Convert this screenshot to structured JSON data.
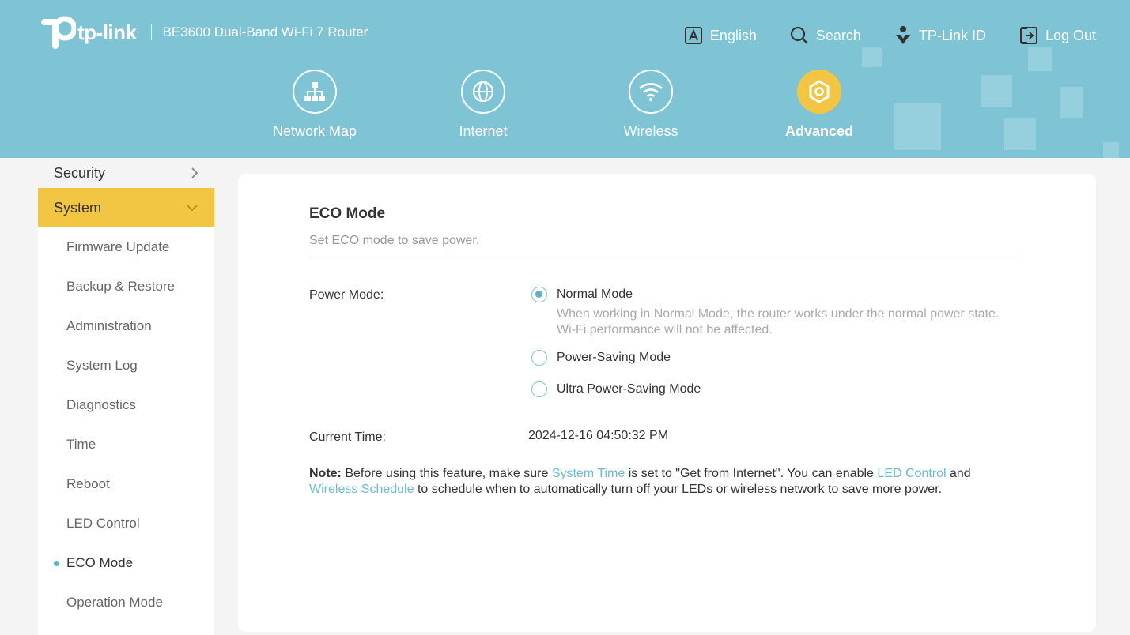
{
  "brand": {
    "logo_text": "tp-link",
    "model": "BE3600 Dual-Band Wi-Fi 7 Router"
  },
  "top_actions": {
    "language": "English",
    "search": "Search",
    "tplink_id": "TP-Link ID",
    "logout": "Log Out"
  },
  "nav": {
    "network_map": "Network Map",
    "internet": "Internet",
    "wireless": "Wireless",
    "advanced": "Advanced",
    "active": "Advanced"
  },
  "sidebar": {
    "security": "Security",
    "system": "System",
    "items": [
      "Firmware Update",
      "Backup & Restore",
      "Administration",
      "System Log",
      "Diagnostics",
      "Time",
      "Reboot",
      "LED Control",
      "ECO Mode",
      "Operation Mode"
    ],
    "active_item": "ECO Mode"
  },
  "content": {
    "title": "ECO Mode",
    "description": "Set ECO mode to save power.",
    "power_mode_label": "Power Mode:",
    "options": {
      "normal": "Normal Mode",
      "normal_hint": "When working in Normal Mode, the router works under the normal power state. Wi-Fi performance will not be affected.",
      "power_saving": "Power-Saving Mode",
      "ultra": "Ultra Power-Saving Mode",
      "selected": "Normal Mode"
    },
    "current_time_label": "Current Time:",
    "current_time": "2024-12-16 04:50:32 PM",
    "note": {
      "label": "Note:",
      "part1": " Before using this feature, make sure ",
      "link_system_time": "System Time",
      "part2": " is set to \"Get from Internet\". You can enable ",
      "link_led_control": "LED Control",
      "part3": " and ",
      "link_wireless_schedule": "Wireless Schedule",
      "part4": " to schedule when to automatically turn off your LEDs or wireless network to save more power."
    }
  },
  "colors": {
    "header": "#7fc4d4",
    "accent_yellow": "#f2c643",
    "link": "#6cbbd0",
    "radio": "#5fb3c8"
  }
}
